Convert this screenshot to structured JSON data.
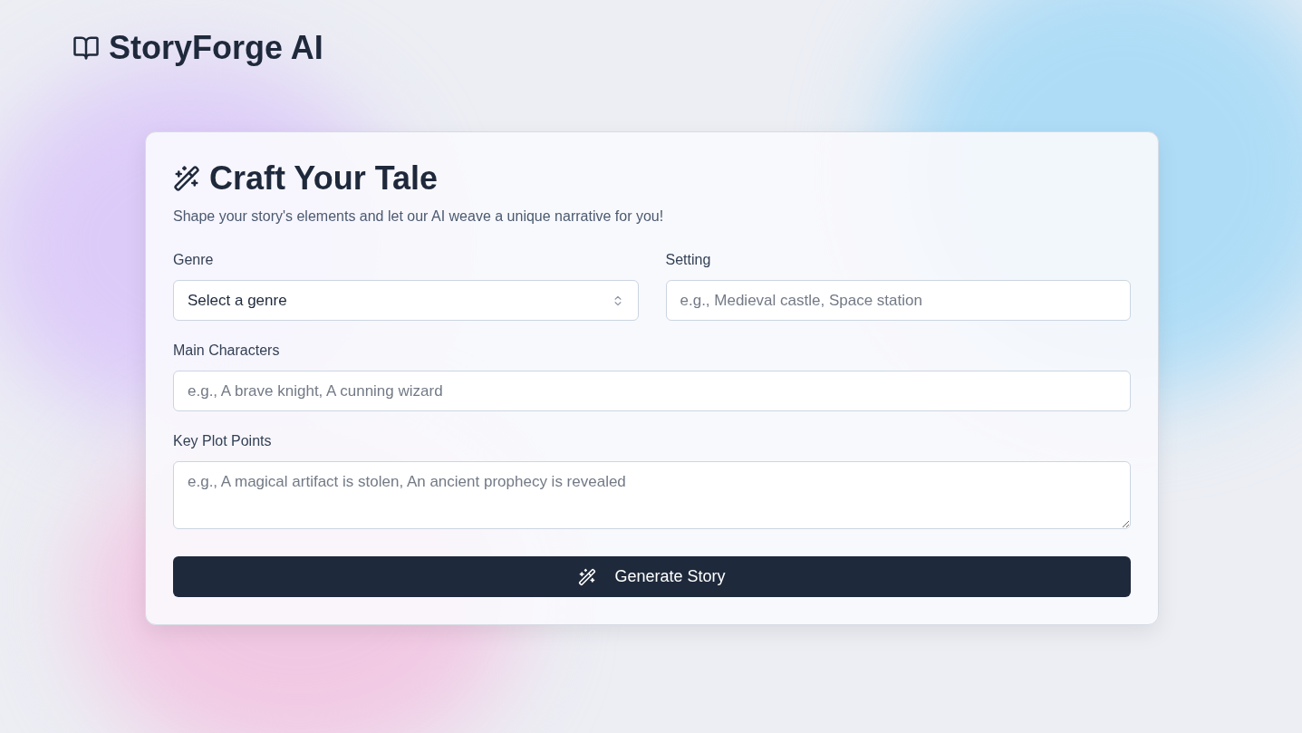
{
  "header": {
    "title": "StoryForge AI"
  },
  "card": {
    "title": "Craft Your Tale",
    "subtitle": "Shape your story's elements and let our AI weave a unique narrative for you!",
    "rows": [
      [
        {
          "label": "Genre",
          "kind": "select",
          "value": "Select a genre"
        },
        {
          "label": "Setting",
          "kind": "input",
          "placeholder": "e.g., Medieval castle, Space station"
        }
      ],
      [
        {
          "label": "Main Characters",
          "kind": "input",
          "placeholder": "e.g., A brave knight, A cunning wizard"
        }
      ],
      [
        {
          "label": "Key Plot Points",
          "kind": "textarea",
          "placeholder": "e.g., A magical artifact is stolen, An ancient prophecy is revealed"
        }
      ]
    ],
    "button": "Generate Story"
  }
}
